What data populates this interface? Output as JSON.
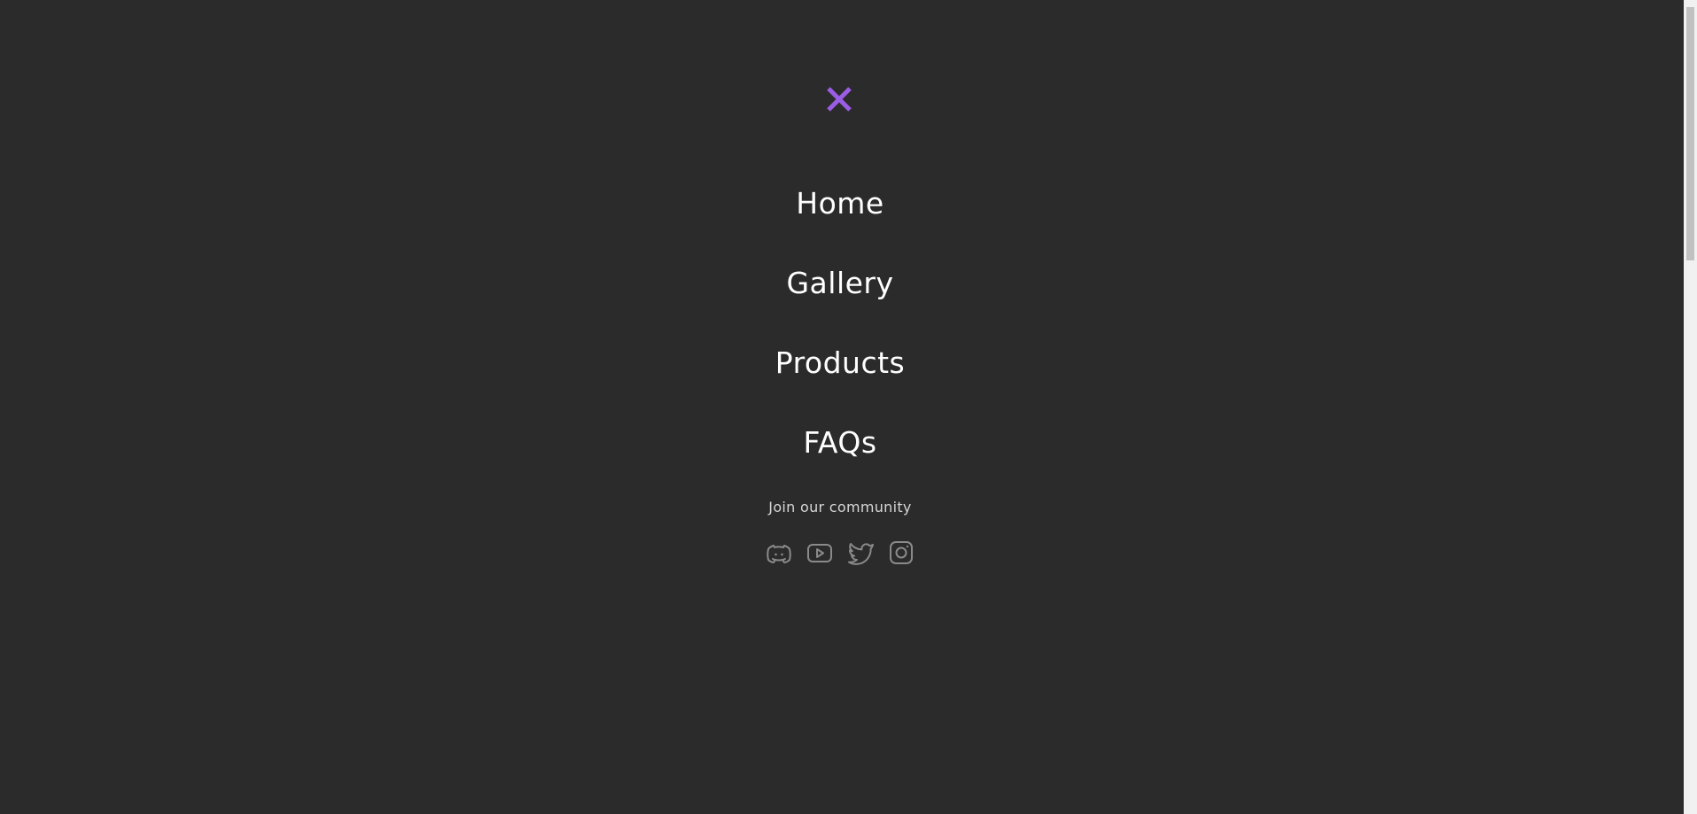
{
  "menu": {
    "close_icon": "close-x-icon",
    "accent_color": "#9b5de5",
    "items": [
      {
        "label": "Home"
      },
      {
        "label": "Gallery"
      },
      {
        "label": "Products"
      },
      {
        "label": "FAQs"
      }
    ],
    "community_label": "Join our community",
    "socials": [
      {
        "icon": "discord-icon"
      },
      {
        "icon": "youtube-icon"
      },
      {
        "icon": "twitter-icon"
      },
      {
        "icon": "instagram-icon"
      }
    ]
  },
  "colors": {
    "background": "#2b2b2b",
    "text": "#ffffff",
    "muted_text": "#d6d6d6",
    "icon": "#8a8a8a"
  }
}
